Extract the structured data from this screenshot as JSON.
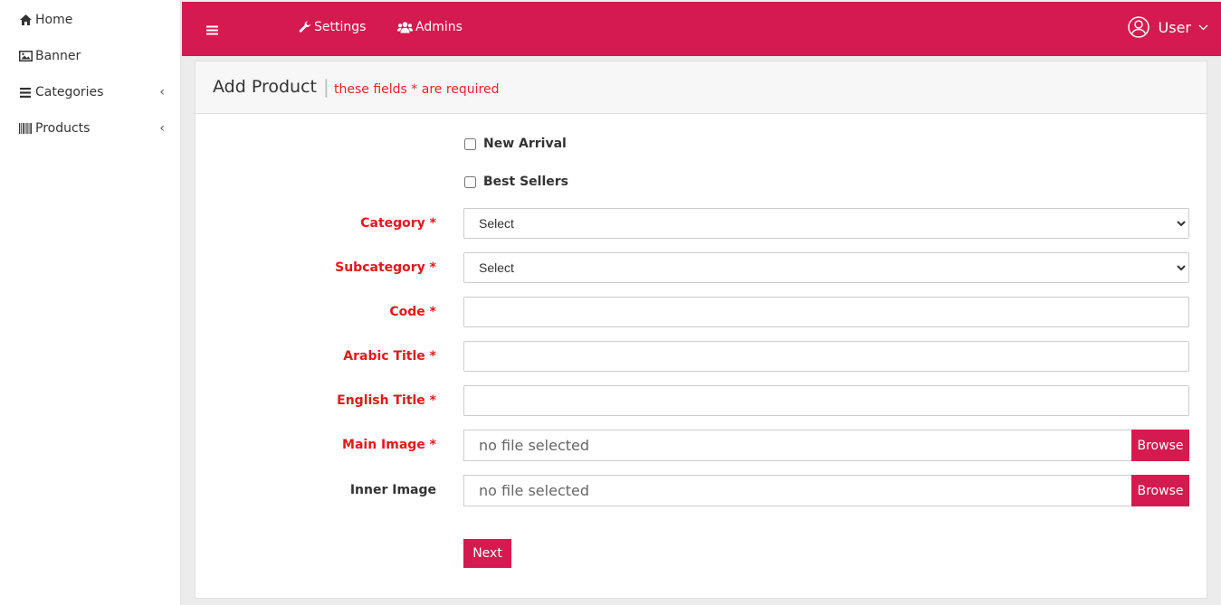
{
  "sidebar": {
    "items": [
      {
        "label": "Home",
        "icon": "home-icon"
      },
      {
        "label": "Banner",
        "icon": "image-icon"
      },
      {
        "label": "Categories",
        "icon": "list-icon"
      },
      {
        "label": "Products",
        "icon": "barcode-icon"
      }
    ]
  },
  "topbar": {
    "menu_icon": "hamburger-icon",
    "settings_label": "Settings",
    "admins_label": "Admins",
    "user_label": "User"
  },
  "page": {
    "title": "Add Product",
    "separator": "|",
    "required_note": "these fields * are required"
  },
  "form": {
    "new_arrival_label": "New Arrival",
    "best_sellers_label": "Best Sellers",
    "category_label": "Category *",
    "category_value": "Select",
    "subcategory_label": "Subcategory *",
    "subcategory_value": "Select",
    "code_label": "Code *",
    "arabic_title_label": "Arabic Title *",
    "english_title_label": "English Title *",
    "main_image_label": "Main Image *",
    "main_image_value": "no file selected",
    "inner_image_label": "Inner Image",
    "inner_image_value": "no file selected",
    "browse_label": "Browse",
    "next_label": "Next"
  },
  "colors": {
    "brand": "#d41a4e",
    "required_red": "#e3171c"
  }
}
